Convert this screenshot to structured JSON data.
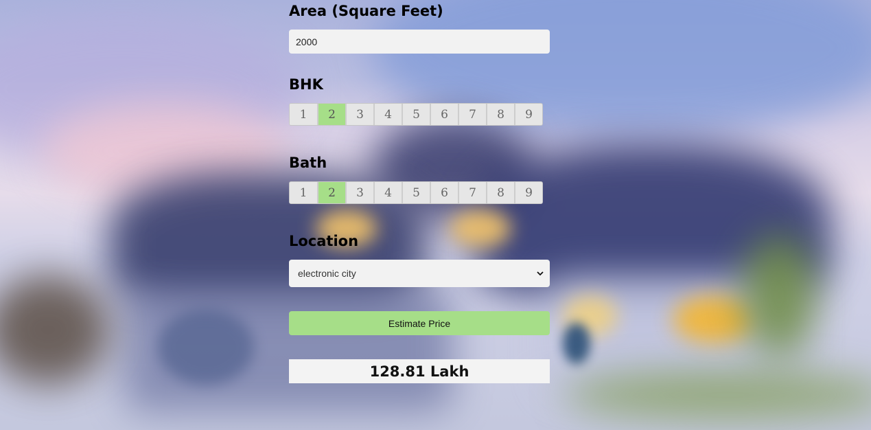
{
  "area": {
    "label": "Area (Square Feet)",
    "value": "2000"
  },
  "bhk": {
    "label": "BHK",
    "options": [
      "1",
      "2",
      "3",
      "4",
      "5",
      "6",
      "7",
      "8",
      "9"
    ],
    "selected": "2"
  },
  "bath": {
    "label": "Bath",
    "options": [
      "1",
      "2",
      "3",
      "4",
      "5",
      "6",
      "7",
      "8",
      "9"
    ],
    "selected": "2"
  },
  "location": {
    "label": "Location",
    "selected": "electronic city",
    "icon": "chevron-down-icon"
  },
  "estimate_button": {
    "label": "Estimate Price"
  },
  "result": {
    "text": "128.81 Lakh"
  },
  "colors": {
    "accent_green": "#a6de88",
    "field_bg": "#f2f2f2"
  }
}
